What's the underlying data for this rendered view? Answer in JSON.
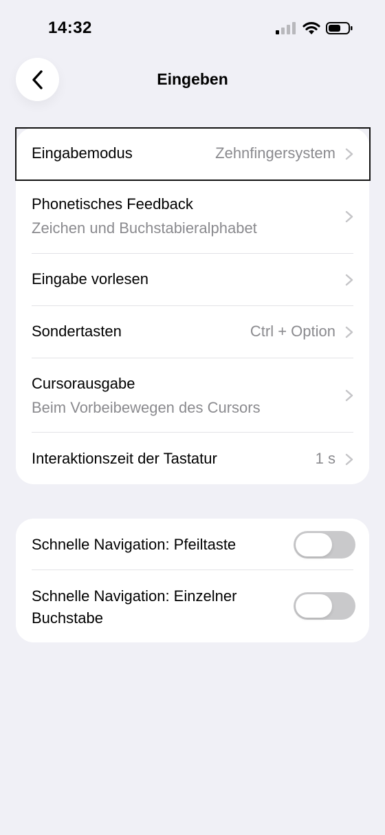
{
  "status_bar": {
    "time": "14:32",
    "icons": [
      "cellular-signal-icon",
      "wifi-icon",
      "battery-icon"
    ]
  },
  "nav": {
    "title": "Eingeben",
    "back_icon": "chevron-left-icon"
  },
  "settings": [
    {
      "title": "Eingabemodus",
      "value": "Zehnfingersystem",
      "focused": true
    },
    {
      "title": "Phonetisches Feedback",
      "subtitle": "Zeichen und Buchstabieralphabet"
    },
    {
      "title": "Eingabe vorlesen"
    },
    {
      "title": "Sondertasten",
      "value": "Ctrl + Option"
    },
    {
      "title": "Cursorausgabe",
      "subtitle": "Beim Vorbeibewegen des Cursors"
    },
    {
      "title": "Interaktionszeit der Tastatur",
      "value": "1 s"
    }
  ],
  "toggles": [
    {
      "title": "Schnelle Navigation: Pfeiltaste",
      "on": false
    },
    {
      "title": "Schnelle Navigation: Einzelner Buchstabe",
      "on": false
    }
  ],
  "colors": {
    "background": "#f0f0f6",
    "card": "#ffffff",
    "secondary_text": "#8a8a8e",
    "toggle_off": "#c9c9cb",
    "focus_outline": "#111111"
  }
}
